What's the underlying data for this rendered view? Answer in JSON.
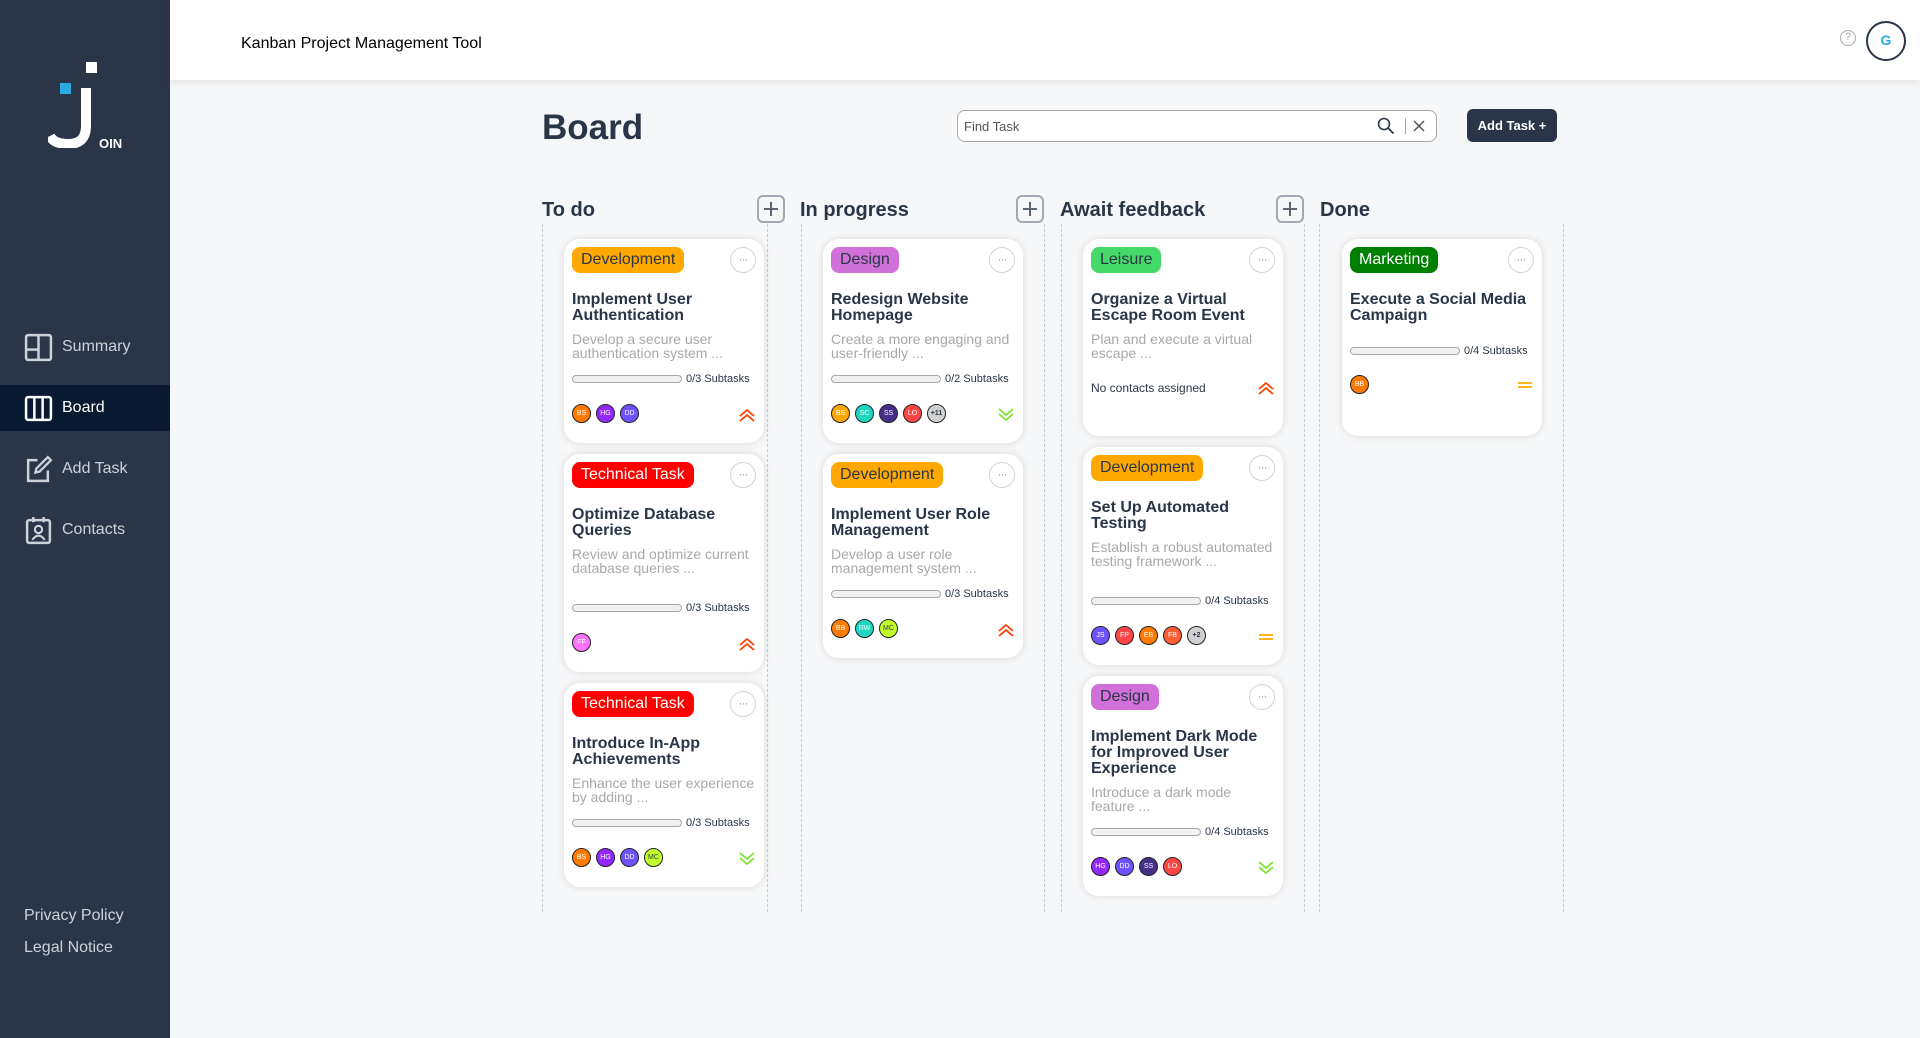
{
  "app": {
    "title": "Kanban Project Management Tool",
    "logo_text": "OIN",
    "help": "?",
    "user_initial": "G"
  },
  "nav": [
    {
      "label": "Summary",
      "icon": "summary-icon"
    },
    {
      "label": "Board",
      "icon": "board-icon"
    },
    {
      "label": "Add Task",
      "icon": "add-task-icon"
    },
    {
      "label": "Contacts",
      "icon": "contacts-icon"
    }
  ],
  "footer": {
    "privacy": "Privacy Policy",
    "legal": "Legal Notice"
  },
  "board": {
    "title": "Board",
    "search_placeholder": "Find Task",
    "add_task": "Add Task +"
  },
  "columns": [
    {
      "title": "To do"
    },
    {
      "title": "In progress"
    },
    {
      "title": "Await feedback"
    },
    {
      "title": "Done"
    }
  ],
  "cards": {
    "c1": {
      "tag": "Development",
      "title": "Implement User Authentication",
      "desc": "Develop a secure user authentication system ...",
      "subtasks": "0/3 Subtasks",
      "avatars": [
        "BS",
        "HG",
        "DD"
      ],
      "priority": "urgent"
    },
    "c2": {
      "tag": "Technical Task",
      "title": "Optimize Database Queries",
      "desc": "Review and optimize current database queries ...",
      "subtasks": "0/3 Subtasks",
      "avatars": [
        "FF"
      ],
      "priority": "urgent"
    },
    "c3": {
      "tag": "Technical Task",
      "title": "Introduce In-App Achievements",
      "desc": "Enhance the user experience by adding ...",
      "subtasks": "0/3 Subtasks",
      "avatars": [
        "BS",
        "HG",
        "DD",
        "MC"
      ],
      "priority": "low"
    },
    "c4": {
      "tag": "Design",
      "title": "Redesign Website Homepage",
      "desc": "Create a more engaging and user-friendly ...",
      "subtasks": "0/2 Subtasks",
      "avatars": [
        "BS",
        "SC",
        "SS",
        "LO",
        "+11"
      ],
      "priority": "low"
    },
    "c5": {
      "tag": "Development",
      "title": "Implement User Role Management",
      "desc": "Develop a user role management system ...",
      "subtasks": "0/3 Subtasks",
      "avatars": [
        "BB",
        "RW",
        "MC"
      ],
      "priority": "urgent"
    },
    "c6": {
      "tag": "Leisure",
      "title": "Organize a Virtual Escape Room Event",
      "desc": "Plan and execute a virtual escape ...",
      "no_contacts": "No contacts assigned",
      "priority": "urgent"
    },
    "c7": {
      "tag": "Development",
      "title": "Set Up Automated Testing",
      "desc": "Establish a robust automated testing framework ...",
      "subtasks": "0/4 Subtasks",
      "avatars": [
        "JS",
        "FP",
        "EB",
        "FB",
        "+2"
      ],
      "priority": "medium"
    },
    "c8": {
      "tag": "Design",
      "title": "Implement Dark Mode for Improved User Experience",
      "desc": "Introduce a dark mode feature ...",
      "subtasks": "0/4 Subtasks",
      "avatars": [
        "HG",
        "DD",
        "SS",
        "LO"
      ],
      "priority": "low"
    },
    "c9": {
      "tag": "Marketing",
      "title": "Execute a Social Media Campaign",
      "subtasks": "0/4 Subtasks",
      "avatars": [
        "BB"
      ],
      "priority": "medium"
    }
  },
  "colors": {
    "sidebar": "#2a3647",
    "accent": "#29abe2",
    "tag_development": "#ffa800",
    "tag_technical": "#ff0000",
    "tag_design": "#d070d8",
    "tag_leisure": "#45d96a",
    "tag_marketing": "#008000",
    "prio_urgent": "#ff3d00",
    "prio_medium": "#ffa800",
    "prio_low": "#7ae229"
  }
}
